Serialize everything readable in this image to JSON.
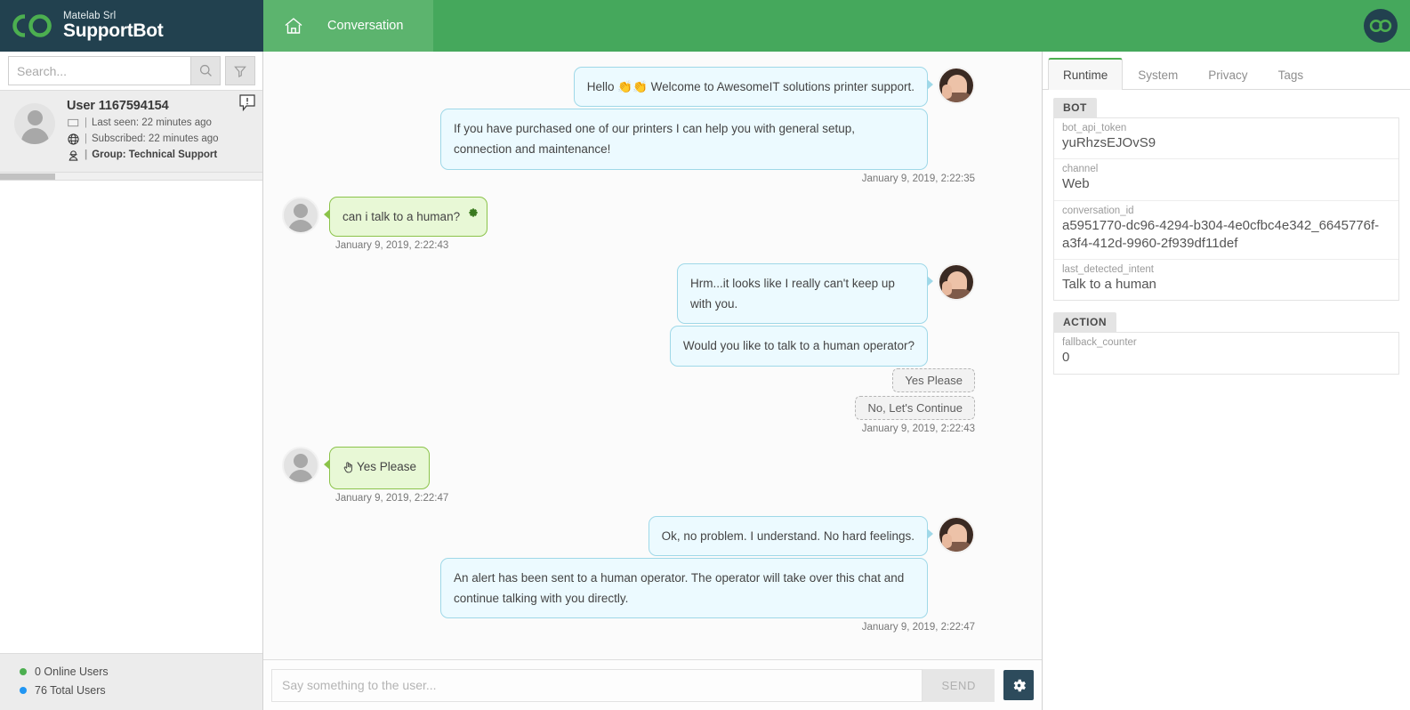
{
  "brand": {
    "company": "Matelab Srl",
    "product": "SupportBot",
    "logo_icon": "infinity-rings-logo"
  },
  "header": {
    "tab_label": "Conversation",
    "home_icon": "home-icon",
    "account_logo_icon": "infinity-rings-badge-icon"
  },
  "sidebar": {
    "search": {
      "placeholder": "Search...",
      "value": ""
    },
    "search_icon": "search-icon",
    "filter_icon": "funnel-filter-icon",
    "user": {
      "name": "User 1167594154",
      "alert_icon": "alert-speech-bubble-icon",
      "avatar_icon": "user-avatar-icon",
      "meta": [
        {
          "icon": "flag-icon",
          "sep": "|",
          "text": "Last seen: 22 minutes ago"
        },
        {
          "icon": "globe-icon",
          "sep": "|",
          "text": "Subscribed: 22 minutes ago"
        },
        {
          "icon": "agent-headset-icon",
          "sep": "|",
          "text": "Group: Technical Support"
        }
      ]
    },
    "footer": {
      "online": {
        "label": "0 Online Users",
        "color": "#4caf50"
      },
      "total": {
        "label": "76 Total Users",
        "color": "#2196f3"
      }
    }
  },
  "chat": {
    "messages": [
      {
        "side": "right",
        "sender": "bot",
        "text": "Hello 👏👏 Welcome to AwesomeIT solutions printer support.",
        "tail": true,
        "avatar": true
      },
      {
        "side": "right",
        "sender": "bot",
        "text": "If you have purchased one of our printers I can help you with general setup, connection and maintenance!",
        "tail": false,
        "avatar": false,
        "wide": true
      },
      {
        "side": "right",
        "type": "timestamp",
        "text": "January 9, 2019, 2:22:35"
      },
      {
        "side": "left",
        "sender": "user",
        "text": "can i talk to a human?",
        "gear": true,
        "avatar": true
      },
      {
        "side": "left",
        "type": "timestamp",
        "text": "January 9, 2019, 2:22:43"
      },
      {
        "side": "right",
        "sender": "bot",
        "text": "Hrm...it looks like I really can't keep up with you.",
        "tail": true,
        "avatar": true,
        "medium": true
      },
      {
        "side": "right",
        "sender": "bot",
        "text": "Would you like to talk to a human operator?",
        "tail": false,
        "avatar": false
      },
      {
        "side": "right",
        "type": "quick_reply",
        "text": "Yes Please"
      },
      {
        "side": "right",
        "type": "quick_reply",
        "text": "No, Let's Continue"
      },
      {
        "side": "right",
        "type": "timestamp",
        "text": "January 9, 2019, 2:22:43"
      },
      {
        "side": "left",
        "sender": "user",
        "text": "Yes Please",
        "cursor": true,
        "avatar": true
      },
      {
        "side": "left",
        "type": "timestamp",
        "text": "January 9, 2019, 2:22:47"
      },
      {
        "side": "right",
        "sender": "bot",
        "text": "Ok, no problem. I understand. No hard feelings.",
        "tail": true,
        "avatar": true
      },
      {
        "side": "right",
        "sender": "bot",
        "text": "An alert has been sent to a human operator. The operator will take over this chat and continue talking with you directly.",
        "tail": false,
        "avatar": false,
        "wide": true
      },
      {
        "side": "right",
        "type": "timestamp",
        "text": "January 9, 2019, 2:22:47"
      }
    ],
    "input": {
      "placeholder": "Say something to the user...",
      "value": ""
    },
    "send_label": "SEND",
    "settings_icon": "gear-icon"
  },
  "right_panel": {
    "tabs": [
      {
        "label": "Runtime",
        "active": true
      },
      {
        "label": "System",
        "active": false
      },
      {
        "label": "Privacy",
        "active": false
      },
      {
        "label": "Tags",
        "active": false
      }
    ],
    "sections": [
      {
        "title": "BOT",
        "rows": [
          {
            "key": "bot_api_token",
            "value": "yuRhzsEJOvS9"
          },
          {
            "key": "channel",
            "value": "Web"
          },
          {
            "key": "conversation_id",
            "value": "a5951770-dc96-4294-b304-4e0cfbc4e342_6645776f-a3f4-412d-9960-2f939df11def"
          },
          {
            "key": "last_detected_intent",
            "value": "Talk to a human"
          }
        ]
      },
      {
        "title": "ACTION",
        "rows": [
          {
            "key": "fallback_counter",
            "value": "0"
          }
        ]
      }
    ]
  },
  "colors": {
    "brand_dark": "#22414f",
    "header_green": "#45a85c",
    "tab_green": "#5cb46e",
    "logo_green": "#4caf50",
    "bot_bubble": "#ecfaff",
    "bot_border": "#9fd8e8",
    "user_bubble": "#e8f8d6",
    "user_border": "#8bc34a"
  }
}
